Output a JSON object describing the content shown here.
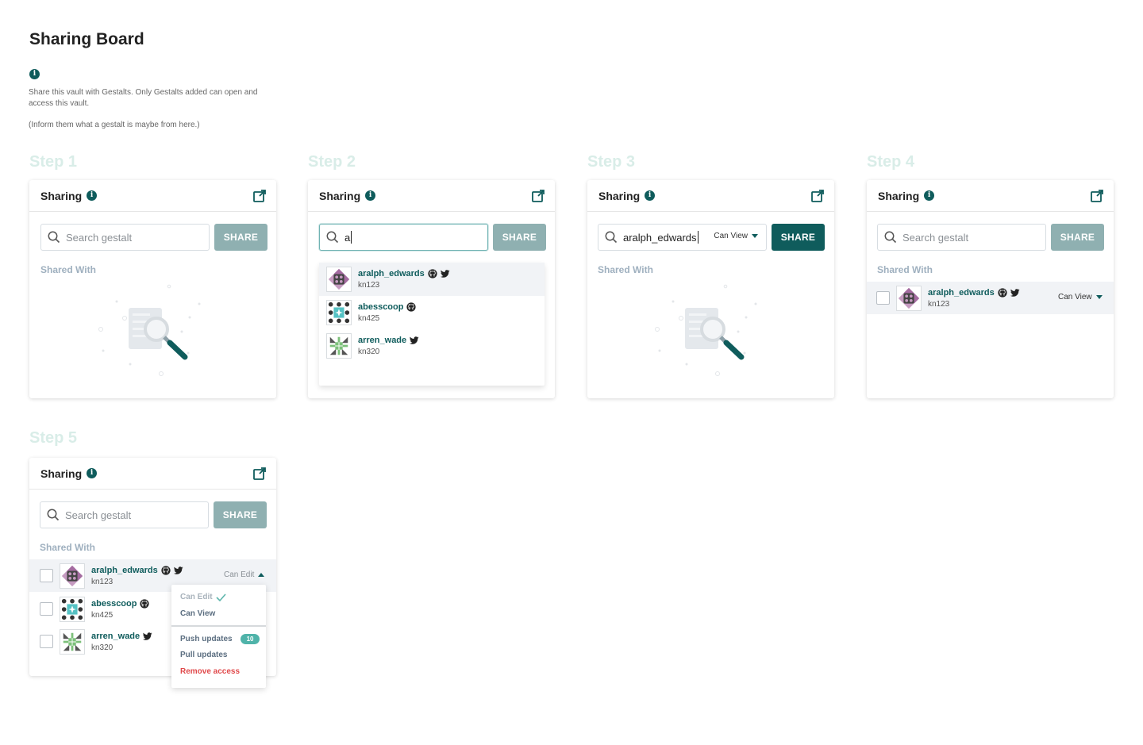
{
  "page": {
    "title": "Sharing Board",
    "description": "Share this vault with Gestalts. Only Gestalts added can open and access this vault.",
    "note": "(Inform them what a gestalt is maybe from here.)"
  },
  "steps": [
    {
      "label": "Step 1"
    },
    {
      "label": "Step 2"
    },
    {
      "label": "Step 3"
    },
    {
      "label": "Step 4"
    },
    {
      "label": "Step 5"
    }
  ],
  "card": {
    "title": "Sharing",
    "search_placeholder": "Search gestalt",
    "share_label": "SHARE",
    "shared_with": "Shared With"
  },
  "step2": {
    "query": "a"
  },
  "step3": {
    "query": "aralph_edwards",
    "permission": "Can View"
  },
  "users": [
    {
      "name": "aralph_edwards",
      "id": "kn123",
      "icons": [
        "github-icon",
        "twitter-icon"
      ]
    },
    {
      "name": "abesscoop",
      "id": "kn425",
      "icons": [
        "github-icon"
      ]
    },
    {
      "name": "arren_wade",
      "id": "kn320",
      "icons": [
        "twitter-icon"
      ]
    }
  ],
  "step4": {
    "permission": "Can View"
  },
  "step5": {
    "permission": "Can Edit",
    "menu": {
      "can_edit": "Can Edit",
      "can_view": "Can View",
      "push_updates": "Push updates",
      "push_count": "10",
      "pull_updates": "Pull updates",
      "remove_access": "Remove access"
    }
  },
  "colors": {
    "primary": "#0f5c5c",
    "muted_button": "#8fb0b1",
    "step_label": "#d9ede8",
    "danger": "#e0494b",
    "badge": "#4fb3a9"
  }
}
